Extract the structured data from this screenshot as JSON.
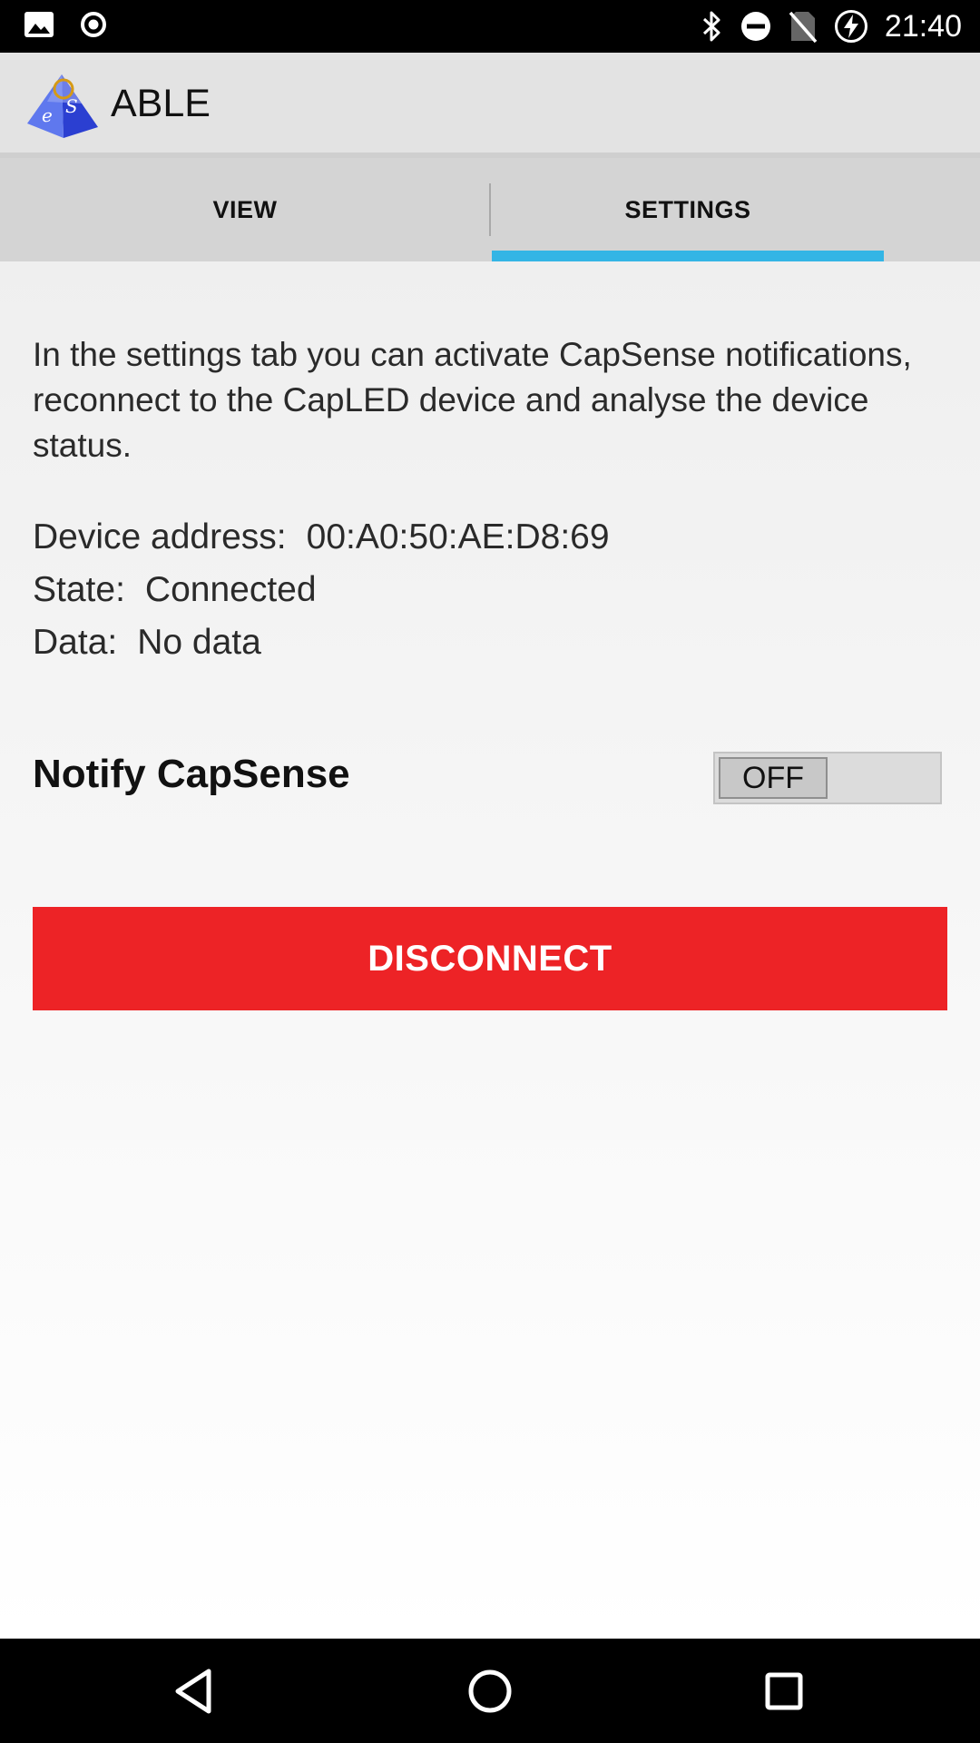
{
  "status_bar": {
    "time": "21:40",
    "icons": [
      "image-notification-icon",
      "record-icon",
      "bluetooth-icon",
      "do-not-disturb-icon",
      "no-sim-icon",
      "battery-charging-icon"
    ]
  },
  "app_bar": {
    "title": "ABLE",
    "logo": "app-logo-pyramid"
  },
  "tabs": [
    {
      "label": "VIEW",
      "selected": false
    },
    {
      "label": "SETTINGS",
      "selected": true
    }
  ],
  "colors": {
    "tab_indicator": "#33b5e5",
    "disconnect_button": "#ed2326"
  },
  "settings": {
    "intro": "In the settings tab you can activate CapSense notifications, reconnect to the CapLED device and analyse the device status.",
    "device_address_label": "Device address:",
    "device_address_value": "00:A0:50:AE:D8:69",
    "state_label": "State:",
    "state_value": "Connected",
    "data_label": "Data:",
    "data_value": "No data",
    "notify_label": "Notify CapSense",
    "notify_toggle": "OFF",
    "disconnect_label": "DISCONNECT"
  },
  "nav_bar": {
    "buttons": [
      "back-icon",
      "home-icon",
      "recents-icon"
    ]
  }
}
